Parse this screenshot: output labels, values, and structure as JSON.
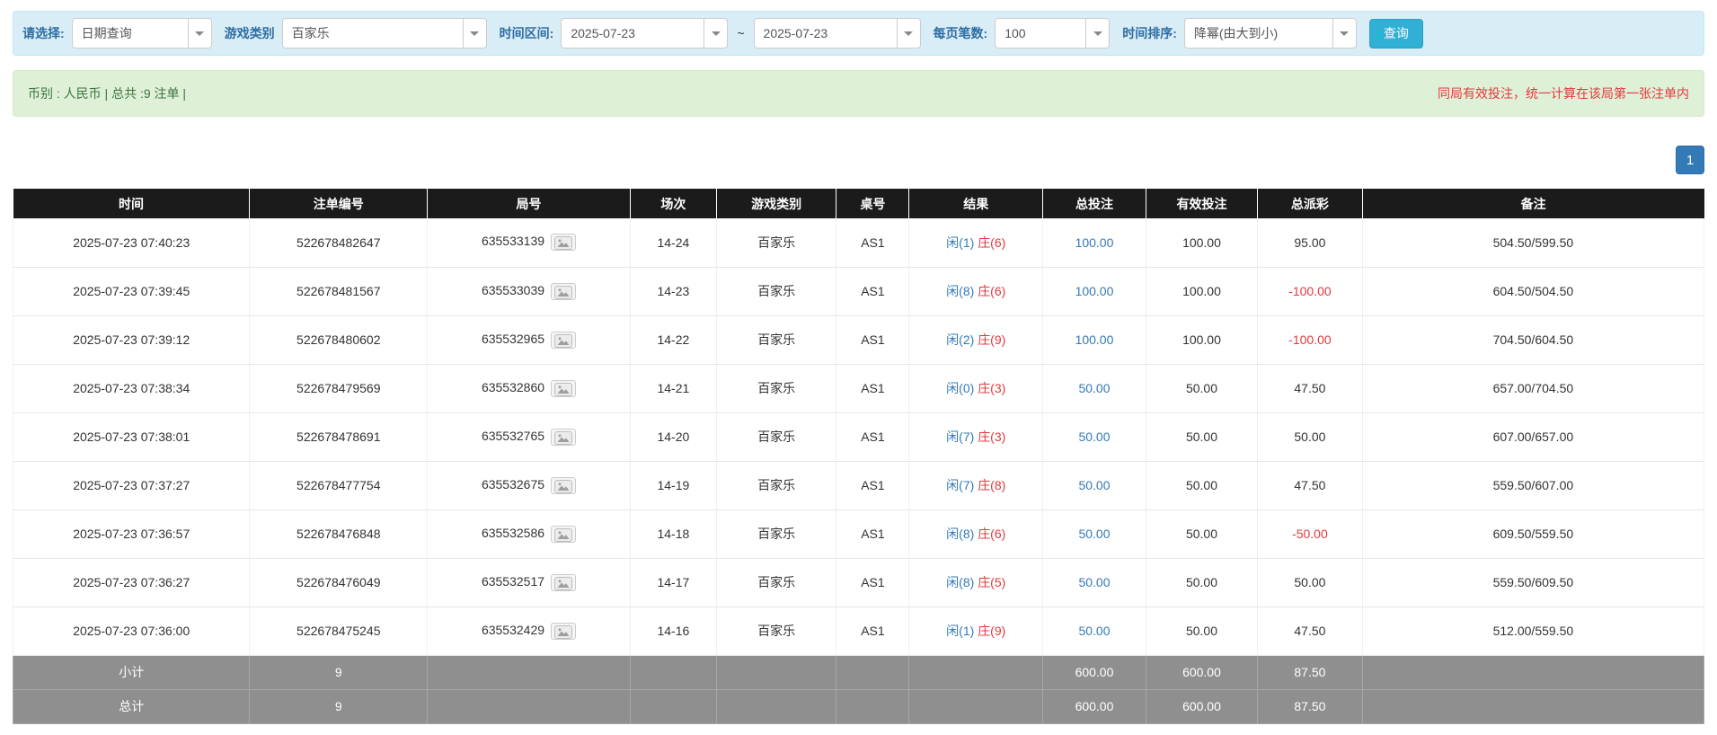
{
  "filters": {
    "select_label": "请选择:",
    "select_value": "日期查询",
    "game_type_label": "游戏类别",
    "game_type_value": "百家乐",
    "time_range_label": "时间区间:",
    "date_from": "2025-07-23",
    "tilde": "~",
    "date_to": "2025-07-23",
    "page_size_label": "每页笔数:",
    "page_size_value": "100",
    "sort_label": "时间排序:",
    "sort_value": "降幂(由大到小)",
    "search_button": "查询"
  },
  "summary": {
    "left": "币别 : 人民币 | 总共 :9 注单 |",
    "right": "同局有效投注，统一计算在该局第一张注单内"
  },
  "pagination": {
    "current": "1"
  },
  "colors": {
    "accent_blue": "#337ab7",
    "banker_red": "#e4393c",
    "header_black": "#1b1b1b",
    "footer_gray": "#8f8f8f",
    "search_cyan": "#31b0d5"
  },
  "icons": {
    "round_icon": "picture-replay-icon",
    "dropdown_caret": "chevron-down-icon"
  },
  "table": {
    "headers": [
      "时间",
      "注单编号",
      "局号",
      "场次",
      "游戏类别",
      "桌号",
      "结果",
      "总投注",
      "有效投注",
      "总派彩",
      "备注"
    ],
    "rows": [
      {
        "time": "2025-07-23 07:40:23",
        "bet_id": "522678482647",
        "round_id": "635533139",
        "session": "14-24",
        "game": "百家乐",
        "table_no": "AS1",
        "player": "闲(1)",
        "banker": "庄(6)",
        "total_bet": "100.00",
        "valid_bet": "100.00",
        "payout": "95.00",
        "remark": "504.50/599.50"
      },
      {
        "time": "2025-07-23 07:39:45",
        "bet_id": "522678481567",
        "round_id": "635533039",
        "session": "14-23",
        "game": "百家乐",
        "table_no": "AS1",
        "player": "闲(8)",
        "banker": "庄(6)",
        "total_bet": "100.00",
        "valid_bet": "100.00",
        "payout": "-100.00",
        "remark": "604.50/504.50"
      },
      {
        "time": "2025-07-23 07:39:12",
        "bet_id": "522678480602",
        "round_id": "635532965",
        "session": "14-22",
        "game": "百家乐",
        "table_no": "AS1",
        "player": "闲(2)",
        "banker": "庄(9)",
        "total_bet": "100.00",
        "valid_bet": "100.00",
        "payout": "-100.00",
        "remark": "704.50/604.50"
      },
      {
        "time": "2025-07-23 07:38:34",
        "bet_id": "522678479569",
        "round_id": "635532860",
        "session": "14-21",
        "game": "百家乐",
        "table_no": "AS1",
        "player": "闲(0)",
        "banker": "庄(3)",
        "total_bet": "50.00",
        "valid_bet": "50.00",
        "payout": "47.50",
        "remark": "657.00/704.50"
      },
      {
        "time": "2025-07-23 07:38:01",
        "bet_id": "522678478691",
        "round_id": "635532765",
        "session": "14-20",
        "game": "百家乐",
        "table_no": "AS1",
        "player": "闲(7)",
        "banker": "庄(3)",
        "total_bet": "50.00",
        "valid_bet": "50.00",
        "payout": "50.00",
        "remark": "607.00/657.00"
      },
      {
        "time": "2025-07-23 07:37:27",
        "bet_id": "522678477754",
        "round_id": "635532675",
        "session": "14-19",
        "game": "百家乐",
        "table_no": "AS1",
        "player": "闲(7)",
        "banker": "庄(8)",
        "total_bet": "50.00",
        "valid_bet": "50.00",
        "payout": "47.50",
        "remark": "559.50/607.00"
      },
      {
        "time": "2025-07-23 07:36:57",
        "bet_id": "522678476848",
        "round_id": "635532586",
        "session": "14-18",
        "game": "百家乐",
        "table_no": "AS1",
        "player": "闲(8)",
        "banker": "庄(6)",
        "total_bet": "50.00",
        "valid_bet": "50.00",
        "payout": "-50.00",
        "remark": "609.50/559.50"
      },
      {
        "time": "2025-07-23 07:36:27",
        "bet_id": "522678476049",
        "round_id": "635532517",
        "session": "14-17",
        "game": "百家乐",
        "table_no": "AS1",
        "player": "闲(8)",
        "banker": "庄(5)",
        "total_bet": "50.00",
        "valid_bet": "50.00",
        "payout": "50.00",
        "remark": "559.50/609.50"
      },
      {
        "time": "2025-07-23 07:36:00",
        "bet_id": "522678475245",
        "round_id": "635532429",
        "session": "14-16",
        "game": "百家乐",
        "table_no": "AS1",
        "player": "闲(1)",
        "banker": "庄(9)",
        "total_bet": "50.00",
        "valid_bet": "50.00",
        "payout": "47.50",
        "remark": "512.00/559.50"
      }
    ],
    "subtotal": {
      "label": "小计",
      "count": "9",
      "total_bet": "600.00",
      "valid_bet": "600.00",
      "payout": "87.50"
    },
    "total": {
      "label": "总计",
      "count": "9",
      "total_bet": "600.00",
      "valid_bet": "600.00",
      "payout": "87.50"
    }
  }
}
